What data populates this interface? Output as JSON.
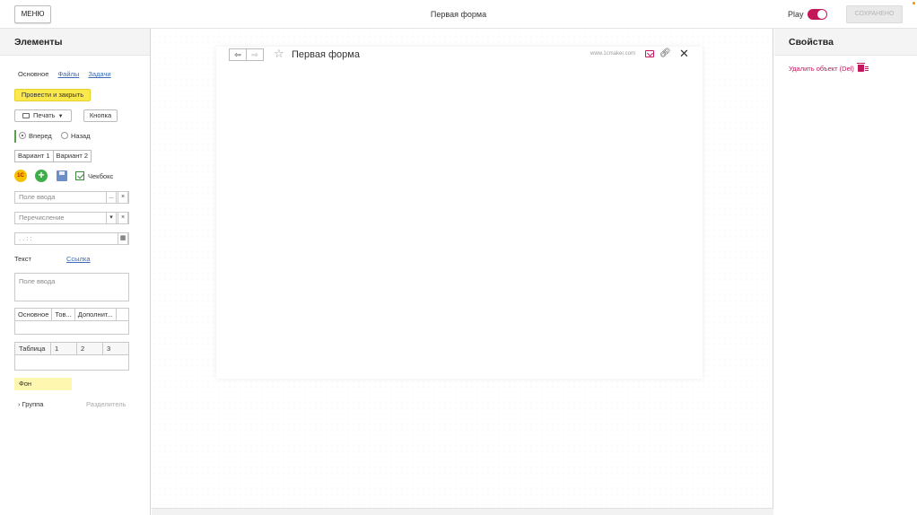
{
  "topbar": {
    "menu_label": "МЕНЮ",
    "title": "Первая форма",
    "play_label": "Play",
    "play_enabled": true,
    "saved_label": "СОХРАНЕНО"
  },
  "left_panel": {
    "title": "Элементы",
    "tabs": [
      {
        "label": "Основное",
        "active": true
      },
      {
        "label": "Файлы",
        "active": false
      },
      {
        "label": "Задачи",
        "active": false
      }
    ],
    "post_close_button": "Провести и закрыть",
    "print_button": "Печать",
    "button_label": "Кнопка",
    "radio": [
      {
        "label": "Вперед",
        "checked": true
      },
      {
        "label": "Назад",
        "checked": false
      }
    ],
    "variants": [
      "Вариант 1",
      "Вариант 2"
    ],
    "icons": [
      "1c-icon",
      "plus-icon",
      "save-icon",
      "checkbox-checked-icon"
    ],
    "checkbox_label": "Чекбокс",
    "input_placeholder": "Поле ввода",
    "input_btn_more": "...",
    "input_btn_clear": "×",
    "enum_placeholder": "Перечисление",
    "enum_btn_dropdown": "▾",
    "enum_btn_clear": "×",
    "date_placeholder": ". . : :",
    "text_label": "Текст",
    "link_label": "Ссылка",
    "textarea_placeholder": "Поле ввода",
    "tabset": [
      "Основное",
      "Тов...",
      "Дополнит..."
    ],
    "table_headers": [
      "Таблица",
      "1",
      "2",
      "3"
    ],
    "background_label": "Фон",
    "group_label": "Группа",
    "separator_label": "Разделитель"
  },
  "form": {
    "title": "Первая форма",
    "site": "www.1cmaker.com"
  },
  "right_panel": {
    "title": "Свойства",
    "delete_label": "Удалить объект (Del)"
  },
  "colors": {
    "accent": "#c2185b",
    "yellow_button": "#fbe84b",
    "link": "#3b6cb5",
    "background_element": "#fdf7b0"
  }
}
